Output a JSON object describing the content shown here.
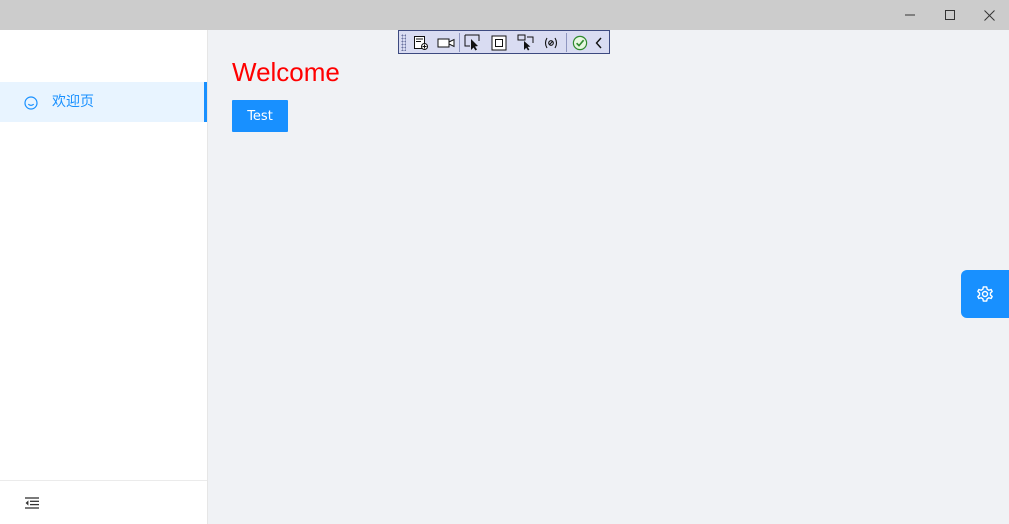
{
  "window": {
    "controls": {
      "minimize": "minimize-icon",
      "maximize": "maximize-icon",
      "close": "close-icon"
    }
  },
  "sidebar": {
    "items": [
      {
        "label": "欢迎页",
        "icon": "smile-icon",
        "active": true
      }
    ],
    "footer": {
      "icon": "collapse-menu-icon"
    }
  },
  "main": {
    "heading": "Welcome",
    "test_button": "Test"
  },
  "debug_toolbar": {
    "tools": [
      "live-visual-tree-icon",
      "record-icon",
      "select-element-icon",
      "display-layout-adorners-icon",
      "track-focus-icon",
      "binding-failures-icon",
      "hot-reload-ok-icon",
      "collapse-toolbar-icon"
    ]
  },
  "settings_fab": {
    "icon": "gear-icon"
  },
  "colors": {
    "accent": "#1890ff",
    "active_bg": "#e8f4ff",
    "heading": "#ff0000",
    "titlebar": "#cccccc",
    "content_bg": "#f0f2f5"
  }
}
